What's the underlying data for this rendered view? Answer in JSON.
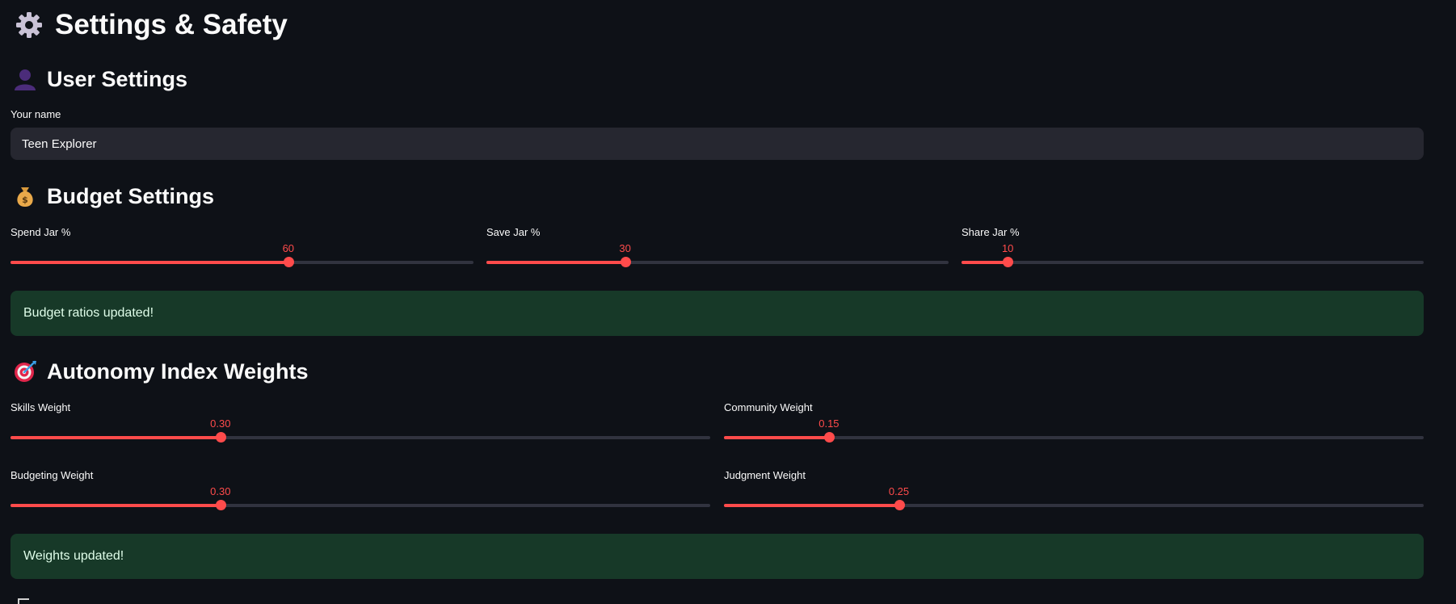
{
  "page": {
    "title": "Settings & Safety",
    "title_icon": "gear-icon"
  },
  "user_settings": {
    "heading": "User Settings",
    "heading_icon": "user-silhouette-icon",
    "name_label": "Your name",
    "name_value": "Teen Explorer"
  },
  "budget_settings": {
    "heading": "Budget Settings",
    "heading_icon": "money-bag-icon",
    "sliders": [
      {
        "label": "Spend Jar %",
        "value": 60,
        "display": "60",
        "min": 0,
        "max": 100
      },
      {
        "label": "Save Jar %",
        "value": 30,
        "display": "30",
        "min": 0,
        "max": 100
      },
      {
        "label": "Share Jar %",
        "value": 10,
        "display": "10",
        "min": 0,
        "max": 100
      }
    ],
    "success_message": "Budget ratios updated!"
  },
  "autonomy_weights": {
    "heading": "Autonomy Index Weights",
    "heading_icon": "target-icon",
    "sliders": [
      {
        "label": "Skills Weight",
        "value": 0.3,
        "display": "0.30",
        "min": 0,
        "max": 1
      },
      {
        "label": "Community Weight",
        "value": 0.15,
        "display": "0.15",
        "min": 0,
        "max": 1
      },
      {
        "label": "Budgeting Weight",
        "value": 0.3,
        "display": "0.30",
        "min": 0,
        "max": 1
      },
      {
        "label": "Judgment Weight",
        "value": 0.25,
        "display": "0.25",
        "min": 0,
        "max": 1
      }
    ],
    "success_message": "Weights updated!"
  },
  "colors": {
    "background": "#0e1117",
    "accent": "#ff4b4b",
    "input_bg": "#262730",
    "success_bg": "#173928",
    "success_text": "#dffde9"
  }
}
